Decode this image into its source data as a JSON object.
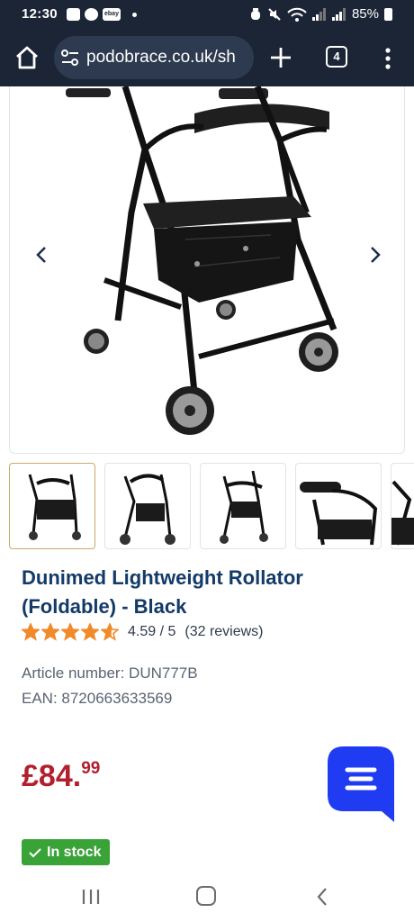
{
  "status_bar": {
    "time": "12:30",
    "notification_icons": [
      "gallery-icon",
      "messenger-icon",
      "ebay-icon"
    ],
    "ebay_label": "ebay",
    "battery": "85%"
  },
  "browser": {
    "url": "podobrace.co.uk/sh",
    "tab_count": "4"
  },
  "gallery": {
    "thumbnails": [
      "Rollator front view",
      "Rollator side view",
      "Rollator angled view",
      "Rollator handle detail",
      "Rollator partial view"
    ]
  },
  "product": {
    "title": "Dunimed Lightweight Rollator (Foldable) - Black",
    "rating": 4.59,
    "rating_text": "4.59 / 5",
    "reviews_text": "(32 reviews)",
    "article_number": "Article number: DUN777B",
    "ean": "EAN: 8720663633569",
    "price_main": "£84.",
    "price_cents": "99",
    "stock_label": "In stock"
  },
  "colors": {
    "title": "#133a68",
    "price": "#b21f2d",
    "star": "#f08a2a",
    "stock": "#3aa337",
    "chat": "#1f3cf2",
    "browser_bar": "#1c2536"
  }
}
